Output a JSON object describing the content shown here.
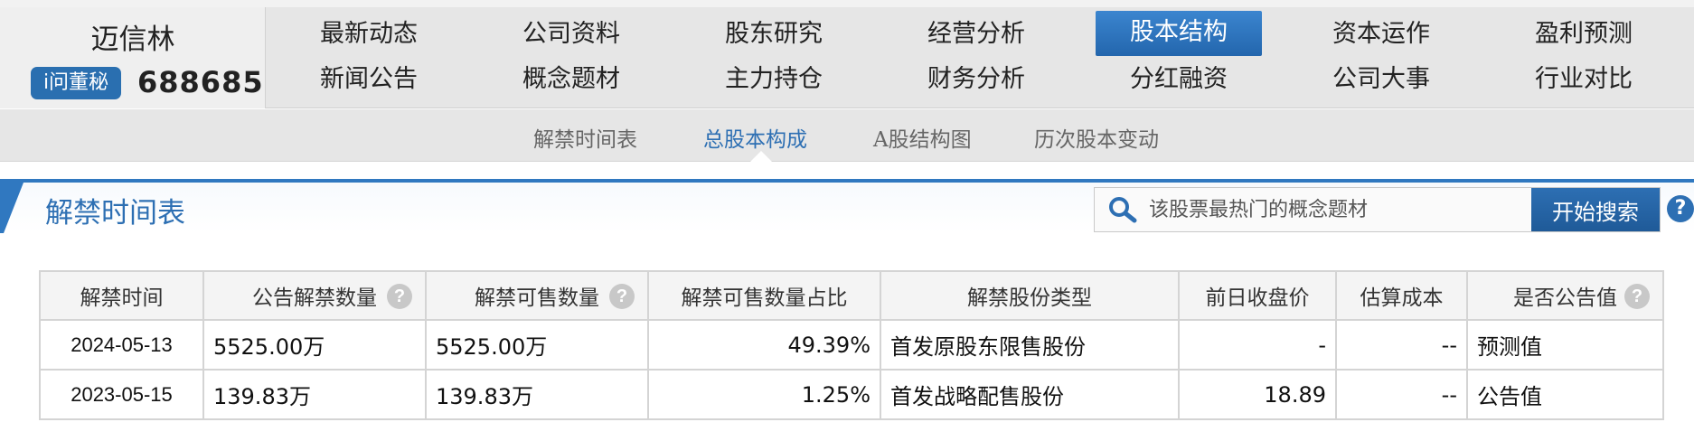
{
  "stock": {
    "name": "迈信林",
    "code": "688685",
    "secretary_label": "i问董秘"
  },
  "nav": {
    "row1": [
      "最新动态",
      "公司资料",
      "股东研究",
      "经营分析",
      "股本结构",
      "资本运作",
      "盈利预测"
    ],
    "row2": [
      "新闻公告",
      "概念题材",
      "主力持仓",
      "财务分析",
      "分红融资",
      "公司大事",
      "行业对比"
    ],
    "active": "股本结构"
  },
  "subnav": {
    "items": [
      "解禁时间表",
      "总股本构成",
      "A股结构图",
      "历次股本变动"
    ],
    "active": "总股本构成"
  },
  "section": {
    "title": "解禁时间表"
  },
  "search": {
    "placeholder": "该股票最热门的概念题材",
    "button_label": "开始搜索",
    "help_label": "?"
  },
  "table": {
    "headers": [
      "解禁时间",
      "公告解禁数量",
      "解禁可售数量",
      "解禁可售数量占比",
      "解禁股份类型",
      "前日收盘价",
      "估算成本",
      "是否公告值"
    ],
    "help_mark": "?",
    "rows": [
      [
        "2024-05-13",
        "5525.00万",
        "5525.00万",
        "49.39%",
        "首发原股东限售股份",
        "-",
        "--",
        "预测值"
      ],
      [
        "2023-05-15",
        "139.83万",
        "139.83万",
        "1.25%",
        "首发战略配售股份",
        "18.89",
        "--",
        "公告值"
      ]
    ]
  },
  "colors": {
    "accent": "#2d6fb3",
    "active_tab": "#2a74bf",
    "header_bg": "#e6e6e6"
  }
}
